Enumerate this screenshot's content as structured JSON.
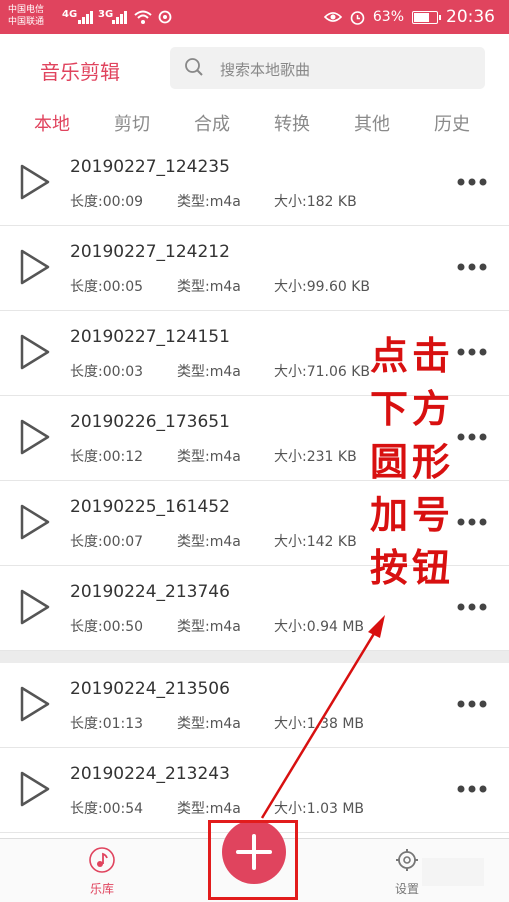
{
  "status_bar": {
    "carrier1": "中国电信",
    "carrier2": "中国联通",
    "net1": "4G",
    "net2": "3G",
    "battery": "63%",
    "time": "20:36"
  },
  "header": {
    "title": "音乐剪辑",
    "search_placeholder": "搜索本地歌曲"
  },
  "tabs": [
    "本地",
    "剪切",
    "合成",
    "转换",
    "其他",
    "历史"
  ],
  "files": [
    {
      "name": "20190227_124235",
      "length": "长度:00:09",
      "type": "类型:m4a",
      "size": "大小:182 KB"
    },
    {
      "name": "20190227_124212",
      "length": "长度:00:05",
      "type": "类型:m4a",
      "size": "大小:99.60 KB"
    },
    {
      "name": "20190227_124151",
      "length": "长度:00:03",
      "type": "类型:m4a",
      "size": "大小:71.06 KB"
    },
    {
      "name": "20190226_173651",
      "length": "长度:00:12",
      "type": "类型:m4a",
      "size": "大小:231 KB"
    },
    {
      "name": "20190225_161452",
      "length": "长度:00:07",
      "type": "类型:m4a",
      "size": "大小:142 KB"
    },
    {
      "name": "20190224_213746",
      "length": "长度:00:50",
      "type": "类型:m4a",
      "size": "大小:0.94 MB"
    },
    {
      "name": "20190224_213506",
      "length": "长度:01:13",
      "type": "类型:m4a",
      "size": "大小:1.38 MB"
    },
    {
      "name": "20190224_213243",
      "length": "长度:00:54",
      "type": "类型:m4a",
      "size": "大小:1.03 MB"
    }
  ],
  "bottom_nav": {
    "library": "乐库",
    "settings": "设置"
  },
  "annotation": {
    "line1": "点击",
    "line2": "下方",
    "line3": "圆形",
    "line4": "加号",
    "line5": "按钮"
  },
  "colors": {
    "accent": "#e0445e",
    "annotation": "#d81010"
  }
}
